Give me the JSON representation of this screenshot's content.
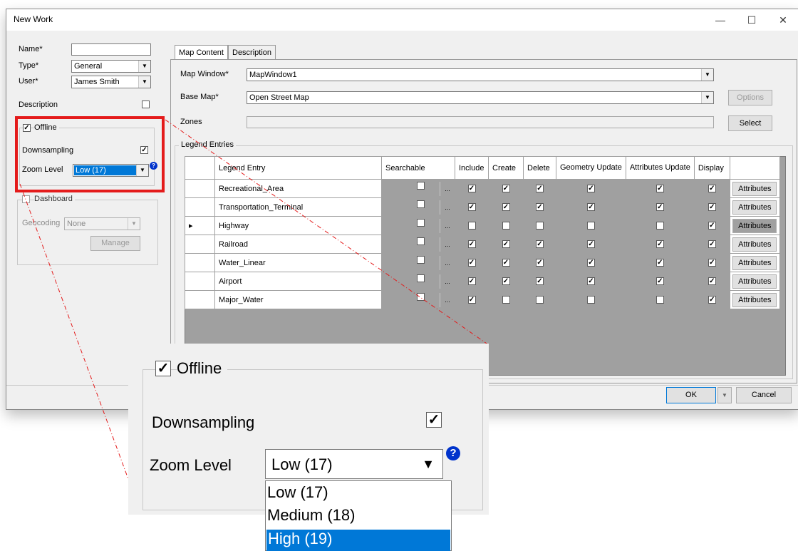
{
  "window": {
    "title": "New Work",
    "minimize_glyph": "—",
    "maximize_glyph": "☐",
    "close_glyph": "✕"
  },
  "left": {
    "name_label": "Name*",
    "name_value": "",
    "type_label": "Type*",
    "type_value": "General",
    "user_label": "User*",
    "user_value": "James Smith",
    "description_label": "Description",
    "offline_label": "Offline",
    "downsampling_label": "Downsampling",
    "zoom_label": "Zoom Level",
    "zoom_value": "Low (17)",
    "dashboard_label": "Dashboard",
    "geocoding_label": "Geocoding",
    "geocoding_value": "None",
    "manage_label": "Manage"
  },
  "tabs": [
    "Map Content",
    "Description"
  ],
  "map": {
    "map_window_label": "Map Window*",
    "map_window_value": "MapWindow1",
    "base_map_label": "Base Map*",
    "base_map_value": "Open Street Map",
    "options_label": "Options",
    "zones_label": "Zones",
    "select_label": "Select",
    "legend_group_label": "Legend Entries"
  },
  "grid": {
    "headers": [
      "Legend Entry",
      "Searchable",
      "Include",
      "Create",
      "Delete",
      "Geometry Update",
      "Attributes Update",
      "Display"
    ],
    "button_label": "Attributes",
    "rows": [
      {
        "name": "Recreational_Area",
        "searchable": false,
        "include": true,
        "create": true,
        "delete": true,
        "geometry": true,
        "attributes": true,
        "display": true,
        "selected": false
      },
      {
        "name": "Transportation_Terminal",
        "searchable": false,
        "include": true,
        "create": true,
        "delete": true,
        "geometry": true,
        "attributes": true,
        "display": true,
        "selected": false
      },
      {
        "name": "Highway",
        "searchable": false,
        "include": false,
        "create": false,
        "delete": false,
        "geometry": false,
        "attributes": false,
        "display": true,
        "selected": true
      },
      {
        "name": "Railroad",
        "searchable": false,
        "include": true,
        "create": true,
        "delete": true,
        "geometry": true,
        "attributes": true,
        "display": true,
        "selected": false
      },
      {
        "name": "Water_Linear",
        "searchable": false,
        "include": true,
        "create": true,
        "delete": true,
        "geometry": true,
        "attributes": true,
        "display": true,
        "selected": false
      },
      {
        "name": "Airport",
        "searchable": false,
        "include": true,
        "create": true,
        "delete": true,
        "geometry": true,
        "attributes": true,
        "display": true,
        "selected": false
      },
      {
        "name": "Major_Water",
        "searchable": false,
        "include": true,
        "create": false,
        "delete": false,
        "geometry": false,
        "attributes": false,
        "display": true,
        "selected": false
      }
    ]
  },
  "footer": {
    "ok_label": "OK",
    "cancel_label": "Cancel"
  },
  "zoom_callout": {
    "offline_label": "Offline",
    "downsampling_label": "Downsampling",
    "zoom_label": "Zoom Level",
    "zoom_value": "Low (17)",
    "options": [
      "Low (17)",
      "Medium (18)",
      "High (19)"
    ],
    "highlighted_option": "High (19)"
  },
  "colors": {
    "highlight_red": "#e41b1b",
    "selection_blue": "#0078d7",
    "grid_gray": "#a0a0a0",
    "help_blue": "#0033cc"
  }
}
